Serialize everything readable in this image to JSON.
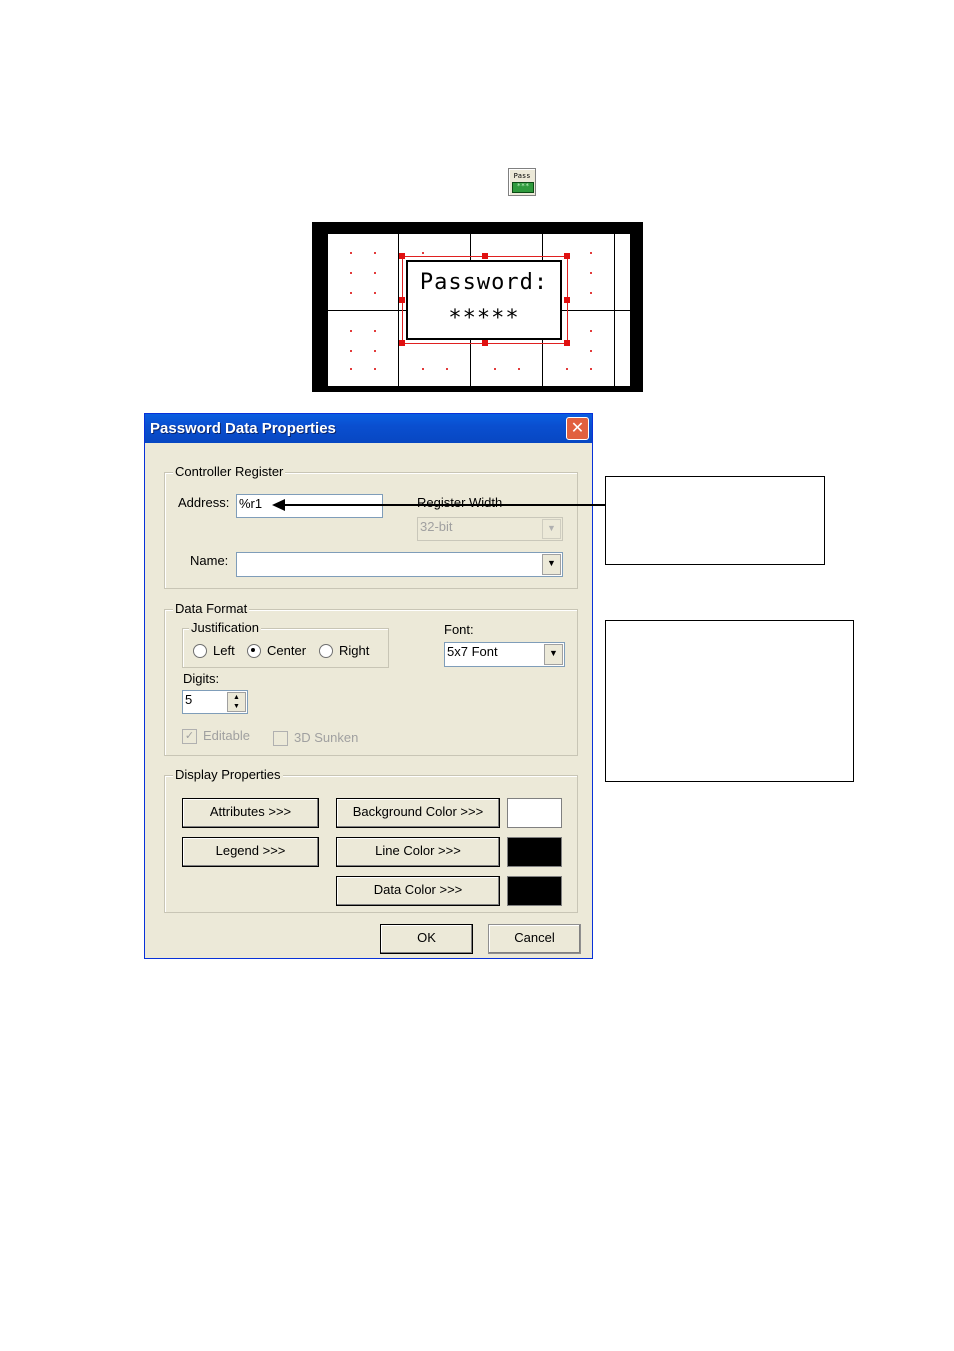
{
  "toolbar_icon": {
    "top_text": "Pass",
    "bottom_text": "***"
  },
  "preview": {
    "label": "Password:",
    "value": "*****"
  },
  "dialog": {
    "title": "Password Data Properties",
    "close_glyph": "✕",
    "controller_register": {
      "group_label": "Controller Register",
      "address_label": "Address:",
      "address_value": "%r1",
      "register_width_label": "Register Width",
      "register_width_value": "32-bit",
      "name_label": "Name:",
      "name_value": ""
    },
    "data_format": {
      "group_label": "Data Format",
      "justification_label": "Justification",
      "options": [
        "Left",
        "Center",
        "Right"
      ],
      "selected": "Center",
      "font_label": "Font:",
      "font_value": "5x7 Font",
      "digits_label": "Digits:",
      "digits_value": "5",
      "editable_label": "Editable",
      "editable_checked": true,
      "sunken_label": "3D Sunken",
      "sunken_checked": false
    },
    "display_properties": {
      "group_label": "Display Properties",
      "attributes_button": "Attributes >>>",
      "legend_button": "Legend >>>",
      "background_color_button": "Background Color >>>",
      "line_color_button": "Line Color >>>",
      "data_color_button": "Data Color >>>",
      "background_color": "#ffffff",
      "line_color": "#000000",
      "data_color": "#000000"
    },
    "ok_button": "OK",
    "cancel_button": "Cancel"
  },
  "icons": {
    "close": "close-icon",
    "dropdown": "chevron-down-icon",
    "spinner": "spin-arrows-icon"
  }
}
